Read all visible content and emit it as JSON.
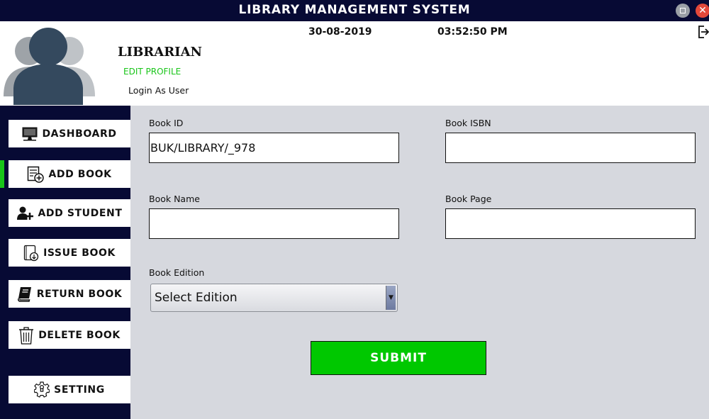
{
  "window": {
    "title": "LIBRARY MANAGEMENT SYSTEM",
    "close_glyph": "✕"
  },
  "header": {
    "role": "LIBRARIAN",
    "edit_profile": "EDIT PROFILE",
    "login_as": "Login As User",
    "date": "30-08-2019",
    "time": "03:52:50 PM"
  },
  "sidebar": {
    "items": [
      {
        "label": "DASHBOARD",
        "icon": "monitor-icon"
      },
      {
        "label": "ADD BOOK",
        "icon": "add-book-icon"
      },
      {
        "label": "ADD STUDENT",
        "icon": "add-user-icon"
      },
      {
        "label": "ISSUE BOOK",
        "icon": "issue-book-icon"
      },
      {
        "label": "RETURN BOOK",
        "icon": "book-icon"
      },
      {
        "label": "DELETE BOOK",
        "icon": "trash-icon"
      },
      {
        "label": "SETTING",
        "icon": "gear-icon"
      }
    ],
    "active_index": 1
  },
  "form": {
    "book_id_label": "Book ID",
    "book_id_value": "BUK/LIBRARY/_978",
    "book_isbn_label": "Book ISBN",
    "book_isbn_value": "",
    "book_name_label": "Book Name",
    "book_name_value": "",
    "book_page_label": "Book Page",
    "book_page_value": "",
    "book_edition_label": "Book Edition",
    "book_edition_selected": "Select Edition",
    "submit_label": "SUBMIT"
  },
  "colors": {
    "navy": "#070a34",
    "accent_green": "#00c800",
    "panel_gray": "#d6d8de"
  }
}
